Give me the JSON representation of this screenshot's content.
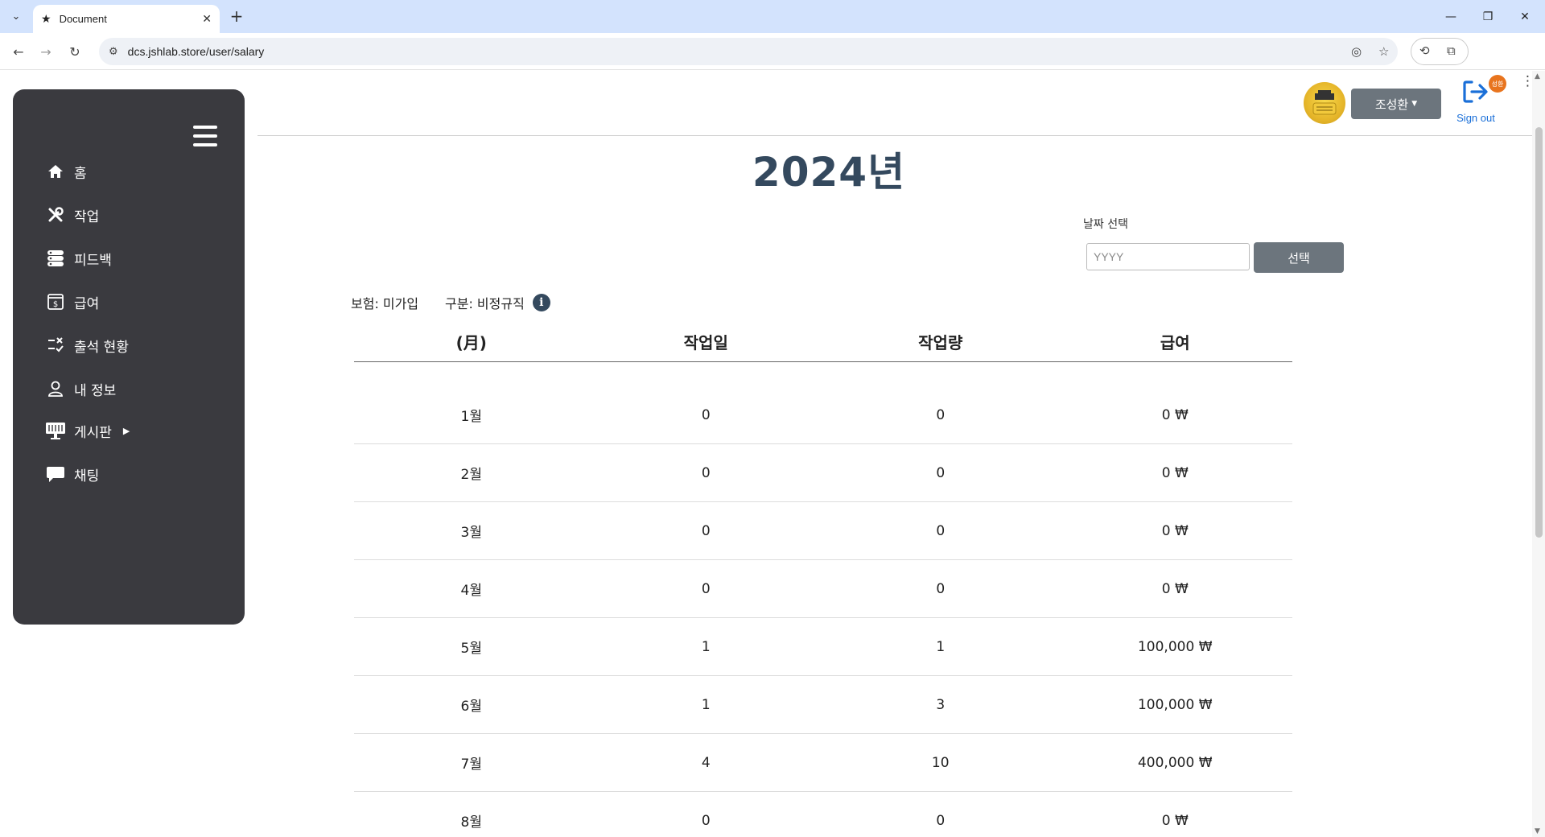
{
  "browser": {
    "tab_title": "Document",
    "url": "dcs.jshlab.store/user/salary",
    "profile_initial": "성환"
  },
  "sidebar": {
    "items": [
      {
        "label": "홈",
        "icon": "home-icon"
      },
      {
        "label": "작업",
        "icon": "tools-icon"
      },
      {
        "label": "피드백",
        "icon": "feedback-icon"
      },
      {
        "label": "급여",
        "icon": "salary-icon"
      },
      {
        "label": "출석 현황",
        "icon": "attendance-icon"
      },
      {
        "label": "내 정보",
        "icon": "user-icon"
      },
      {
        "label": "게시판",
        "icon": "board-icon"
      },
      {
        "label": "채팅",
        "icon": "chat-icon"
      }
    ]
  },
  "header": {
    "user_name": "조성환",
    "signout_label": "Sign out"
  },
  "main": {
    "year_title": "2024년",
    "date_label": "날짜 선택",
    "date_placeholder": "YYYY",
    "select_label": "선택",
    "insurance": "보험: 미가입",
    "category": "구분: 비정규직",
    "table": {
      "headers": [
        "(月)",
        "작업일",
        "작업량",
        "급여"
      ],
      "rows": [
        [
          "1월",
          "0",
          "0",
          "0 ₩"
        ],
        [
          "2월",
          "0",
          "0",
          "0 ₩"
        ],
        [
          "3월",
          "0",
          "0",
          "0 ₩"
        ],
        [
          "4월",
          "0",
          "0",
          "0 ₩"
        ],
        [
          "5월",
          "1",
          "1",
          "100,000 ₩"
        ],
        [
          "6월",
          "1",
          "3",
          "100,000 ₩"
        ],
        [
          "7월",
          "4",
          "10",
          "400,000 ₩"
        ],
        [
          "8월",
          "0",
          "0",
          "0 ₩"
        ]
      ]
    }
  },
  "colors": {
    "sidebar_bg": "#3a3a3f",
    "title_color": "#34495e",
    "button_gray": "#6c757d",
    "signout_blue": "#1a6fd8"
  }
}
